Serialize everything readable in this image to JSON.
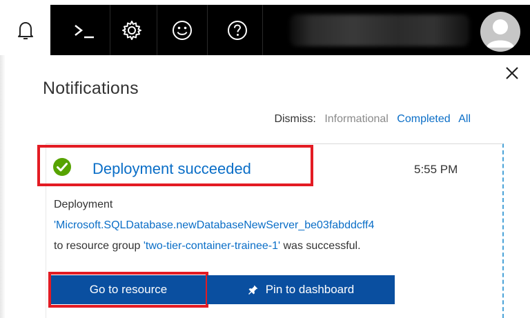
{
  "toolbar": {
    "items": [
      {
        "icon": "bell-icon",
        "active": true
      },
      {
        "icon": "cloud-shell-icon",
        "active": false
      },
      {
        "icon": "gear-icon",
        "active": false
      },
      {
        "icon": "smiley-feedback-icon",
        "active": false
      },
      {
        "icon": "help-icon",
        "active": false
      }
    ],
    "account": {
      "blurred": true
    },
    "avatar": {
      "icon": "avatar-icon"
    }
  },
  "panel": {
    "title": "Notifications",
    "close_icon": "close-icon",
    "dismiss": {
      "label": "Dismiss:",
      "informational": "Informational",
      "completed": "Completed",
      "all": "All"
    }
  },
  "notification": {
    "status_icon": "check-circle-icon",
    "title": "Deployment succeeded",
    "time": "5:55 PM",
    "message": {
      "line1": "Deployment",
      "link1": "'Microsoft.SQLDatabase.newDatabaseNewServer_be03fabddcff4",
      "prefix2": "to resource group ",
      "link2": "'two-tier-container-trainee-1'",
      "suffix2": " was successful."
    },
    "buttons": {
      "go_to_resource": "Go to resource",
      "pin_to_dashboard": "Pin to dashboard"
    }
  },
  "colors": {
    "toolbar_bg": "#000000",
    "link": "#0a6ec7",
    "button_bg": "#0a4fa0",
    "highlight": "#e31b23",
    "success": "#57a300"
  }
}
